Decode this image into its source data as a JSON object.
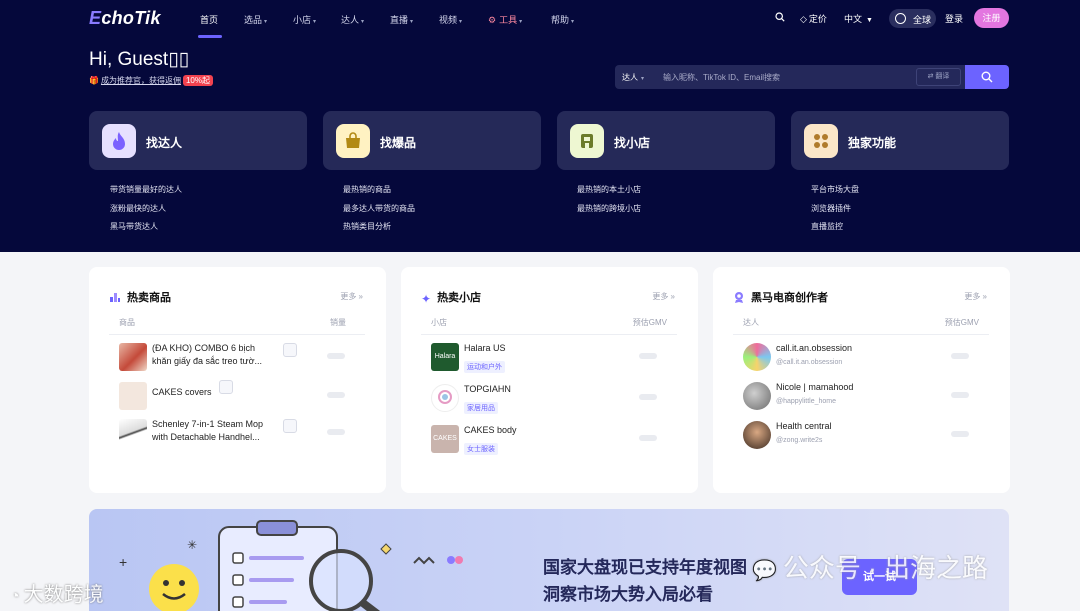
{
  "brand": {
    "logo_e": "E",
    "logo_rest": "choTik",
    "accent": "#6c63ff",
    "hero_bg": "#05083b"
  },
  "nav": {
    "items": [
      {
        "label": "首页",
        "chevron": false
      },
      {
        "label": "选品",
        "chevron": true
      },
      {
        "label": "小店",
        "chevron": true
      },
      {
        "label": "达人",
        "chevron": true
      },
      {
        "label": "直播",
        "chevron": true
      },
      {
        "label": "视频",
        "chevron": true
      },
      {
        "label": "工具",
        "chevron": true
      },
      {
        "label": "帮助",
        "chevron": true
      }
    ],
    "pricing": "定价",
    "language": "中文",
    "region": "全球",
    "login": "登录",
    "register": "注册"
  },
  "hero": {
    "greeting": "Hi, Guest▯▯",
    "promo_text": "成为推荐官，获得返佣",
    "promo_badge": "10%起"
  },
  "search": {
    "type": "达人",
    "placeholder": "输入昵称、TikTok ID、Email搜索",
    "translate": "翻译"
  },
  "quick_cards": [
    {
      "title": "找达人",
      "icon": "flame-icon",
      "links": [
        "带货销量最好的达人",
        "涨粉最快的达人",
        "黑马带货达人"
      ]
    },
    {
      "title": "找爆品",
      "icon": "shopping-bag-icon",
      "links": [
        "最热销的商品",
        "最多达人带货的商品",
        "热销类目分析"
      ]
    },
    {
      "title": "找小店",
      "icon": "store-icon",
      "links": [
        "最热销的本土小店",
        "最热销的跨境小店"
      ]
    },
    {
      "title": "独家功能",
      "icon": "grid-icon",
      "links": [
        "平台市场大盘",
        "浏览器插件",
        "直播监控"
      ]
    }
  ],
  "panels": {
    "products": {
      "title": "热卖商品",
      "more": "更多 »",
      "col1": "商品",
      "col2": "销量",
      "rows": [
        {
          "name": "(ĐA KHO) COMBO 6 bịch khăn giấy đa sắc treo tườ..."
        },
        {
          "name": "CAKES covers"
        },
        {
          "name": "Schenley 7-in-1 Steam Mop with Detachable Handhel..."
        }
      ]
    },
    "shops": {
      "title": "热卖小店",
      "more": "更多 »",
      "col1": "小店",
      "col2": "预估GMV",
      "rows": [
        {
          "name": "Halara US",
          "tag": "运动和户外",
          "thumb_text": "Halara"
        },
        {
          "name": "TOPGIAHN",
          "tag": "家居用品",
          "thumb_text": ""
        },
        {
          "name": "CAKES body",
          "tag": "女士服装",
          "thumb_text": "CAKES"
        }
      ]
    },
    "creators": {
      "title": "黑马电商创作者",
      "more": "更多 »",
      "col1": "达人",
      "col2": "预估GMV",
      "rows": [
        {
          "name": "call.it.an.obsession",
          "handle": "@call.it.an.obsession"
        },
        {
          "name": "Nicole | mamahood",
          "handle": "@happylittle_home"
        },
        {
          "name": "Health central",
          "handle": "@zong.write2s"
        }
      ]
    }
  },
  "banner": {
    "line1": "国家大盘现已支持年度视图",
    "line2": "洞察市场大势入局必看",
    "button": "试一试"
  },
  "watermarks": {
    "left": "大数跨境",
    "right": "公众号 · 出海之路"
  }
}
